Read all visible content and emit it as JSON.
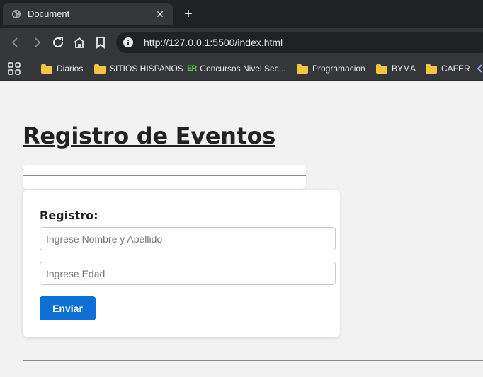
{
  "browser": {
    "tab": {
      "title": "Document",
      "close_symbol": "✕"
    },
    "new_tab_symbol": "+",
    "address_bar": {
      "url": "http://127.0.0.1:5500/index.html"
    },
    "bookmarks": [
      {
        "label": "Diarios",
        "icon": "folder-icon"
      },
      {
        "label": "SITIOS HISPANOS",
        "icon": "folder-icon"
      },
      {
        "label": "Concursos Nivel Sec...",
        "icon": "er-logo-icon"
      },
      {
        "label": "Programacion",
        "icon": "folder-icon"
      },
      {
        "label": "BYMA",
        "icon": "folder-icon"
      },
      {
        "label": "CAFER",
        "icon": "folder-icon"
      }
    ],
    "er_logo_text": "ER",
    "colors": {
      "tabstrip": "#202124",
      "toolbar": "#35363a",
      "folder": "#f5c542"
    }
  },
  "page": {
    "title": "Registro de Eventos",
    "form": {
      "heading": "Registro:",
      "name_input": {
        "placeholder": "Ingrese Nombre y Apellido",
        "value": ""
      },
      "age_input": {
        "placeholder": "Ingrese Edad",
        "value": ""
      },
      "submit_label": "Enviar"
    },
    "colors": {
      "background": "#f2f2f2",
      "button": "#0b6fd6"
    }
  }
}
